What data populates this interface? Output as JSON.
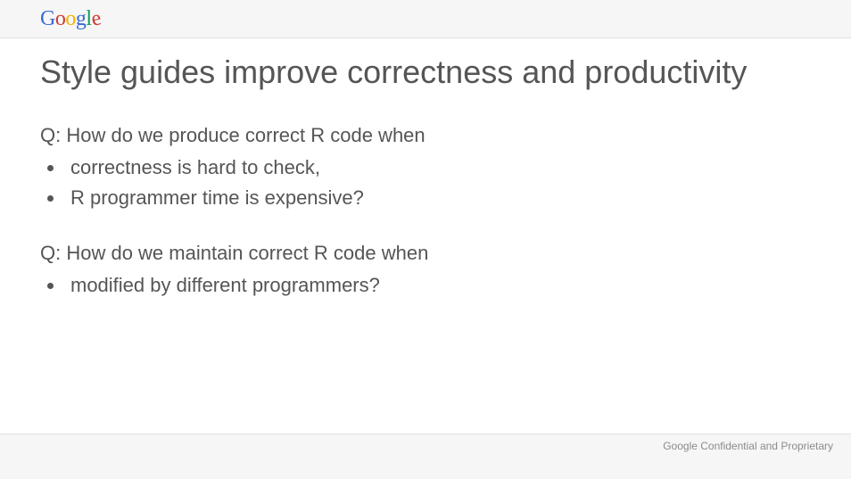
{
  "logo_letters": [
    "G",
    "o",
    "o",
    "g",
    "l",
    "e"
  ],
  "title": "Style guides improve correctness and productivity",
  "block1": {
    "question": "Q: How do we produce correct R code when",
    "bullets": [
      "correctness is hard to check,",
      "R programmer time is expensive?"
    ]
  },
  "block2": {
    "question": "Q: How do we maintain correct R code when",
    "bullets": [
      "modified by different programmers?"
    ]
  },
  "footer": "Google Confidential and Proprietary"
}
